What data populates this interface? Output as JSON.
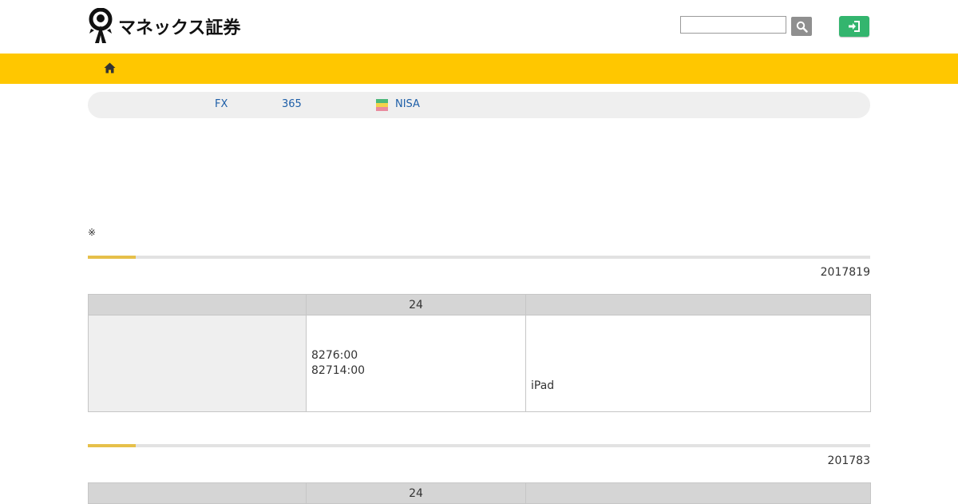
{
  "header": {
    "logo_text": "マネックス証券",
    "search": {
      "value": "",
      "placeholder": ""
    },
    "search_icon": "search-icon",
    "login_icon": "sign-in-icon"
  },
  "navbar": {
    "home_icon": "home-icon"
  },
  "subnav": {
    "items": [
      {
        "label": "FX"
      },
      {
        "label": "365"
      },
      {
        "label": "NISA"
      }
    ]
  },
  "note": "※",
  "sections": [
    {
      "date": "2017819",
      "table": {
        "headers": [
          "",
          "24",
          ""
        ],
        "row": {
          "label": "",
          "col2_lines": [
            "8276:00",
            "82714:00"
          ],
          "col3_text": "iPad"
        }
      }
    },
    {
      "date": "201783",
      "table": {
        "headers": [
          "",
          "24",
          ""
        ]
      }
    }
  ],
  "colors": {
    "navbar": "#ffc700",
    "login_button": "#33b56e",
    "link": "#1e5fa8",
    "accent_line": "#e6c04a"
  }
}
